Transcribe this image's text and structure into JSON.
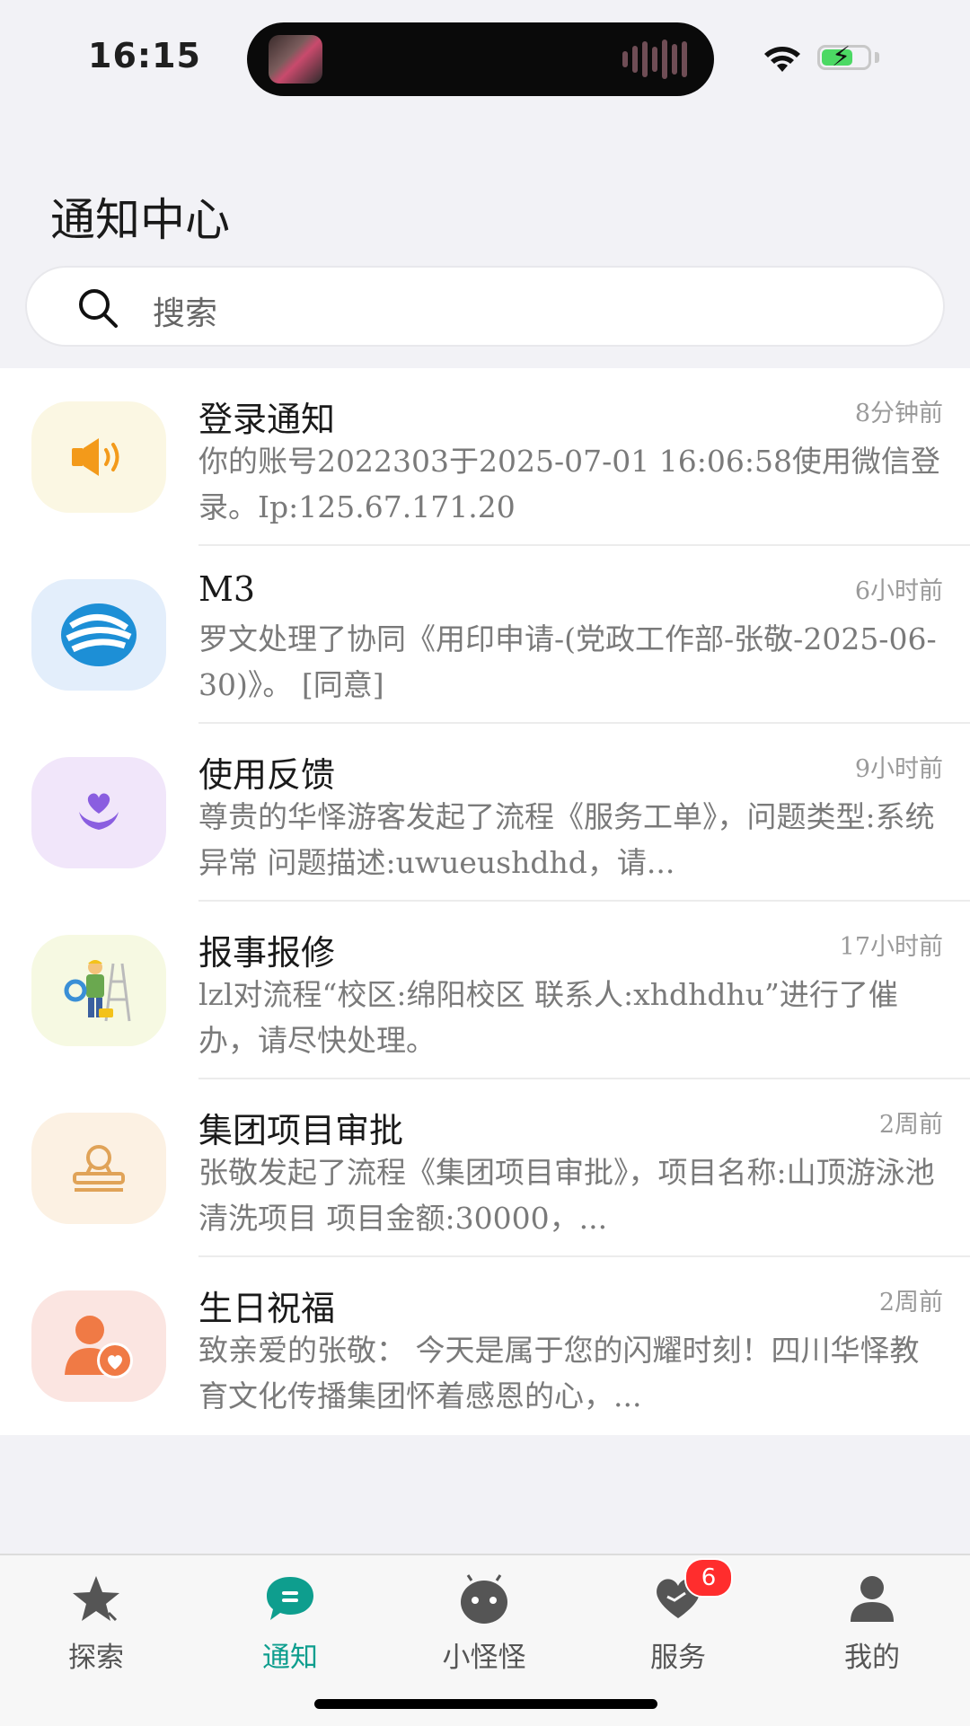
{
  "status_bar": {
    "time": "16:15"
  },
  "header": {
    "title": "通知中心"
  },
  "search": {
    "placeholder": "搜索"
  },
  "notifications": [
    {
      "title": "登录通知",
      "time": "8分钟前",
      "body": "你的账号2022303于2025-07-01 16:06:58使用微信登录。Ip:125.67.171.20",
      "icon": "speaker-icon",
      "bg": "#fbf7e3"
    },
    {
      "title": "M3",
      "time": "6小时前",
      "body": "罗文处理了协同《用印申请-(党政工作部-张敬-2025-06-30)》。 [同意]",
      "icon": "m3-logo-icon",
      "bg": "#e3eefb"
    },
    {
      "title": "使用反馈",
      "time": "9小时前",
      "body": "尊贵的华怿游客发起了流程《服务工单》，问题类型:系统异常 问题描述:uwueushdhd，请...",
      "icon": "heart-hand-icon",
      "bg": "#f1e6fa"
    },
    {
      "title": "报事报修",
      "time": "17小时前",
      "body": "lzl对流程“校区:绵阳校区 联系人:xhdhdhu”进行了催办，请尽快处理。",
      "icon": "repair-worker-icon",
      "bg": "#f6f9e2"
    },
    {
      "title": "集团项目审批",
      "time": "2周前",
      "body": "张敬发起了流程《集团项目审批》，项目名称:山顶游泳池清洗项目 项目金额:30000，...",
      "icon": "stamp-icon",
      "bg": "#fcf1e3"
    },
    {
      "title": "生日祝福",
      "time": "2周前",
      "body": "致亲爱的张敬： 今天是属于您的闪耀时刻！四川华怿教育文化传播集团怀着感恩的心，...",
      "icon": "person-heart-icon",
      "bg": "#fbe5e1"
    }
  ],
  "tabbar": {
    "tabs": [
      {
        "label": "探索",
        "icon": "star-icon",
        "active": false
      },
      {
        "label": "通知",
        "icon": "chat-bubble-icon",
        "active": true
      },
      {
        "label": "小怪怪",
        "icon": "android-robot-icon",
        "active": false
      },
      {
        "label": "服务",
        "icon": "heart-handshake-icon",
        "active": false,
        "badge": "6"
      },
      {
        "label": "我的",
        "icon": "user-icon",
        "active": false
      }
    ]
  },
  "colors": {
    "accent": "#0e9e8e",
    "badge": "#ff2d2d"
  }
}
